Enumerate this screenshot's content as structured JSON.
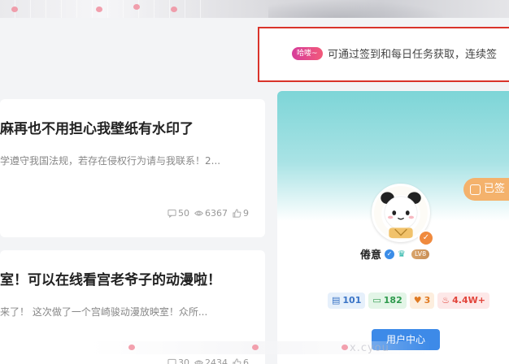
{
  "notice": {
    "tag": "哈喽~",
    "text": "可通过签到和每日任务获取，连续签"
  },
  "posts": [
    {
      "title": "麻再也不用担心我壁纸有水印了",
      "excerpt": "学遵守我国法规，若存在侵权行为请与我联系！2...",
      "comments": "50",
      "views": "6367",
      "likes": "9"
    },
    {
      "title": "室！可以在线看宫老爷子的动漫啦！",
      "excerpt": "来了！ 这次做了一个宫崎骏动漫放映室！众所...",
      "comments": "30",
      "views": "2434",
      "likes": "6"
    }
  ],
  "profile": {
    "signed_label": "已签",
    "username": "倦意",
    "level": "LV8",
    "counters": {
      "posts": "101",
      "comments": "182",
      "likes": "3",
      "popularity": "4.4W+"
    },
    "user_center_label": "用户中心"
  },
  "watermark": "x.cyou",
  "colors": {
    "accent": "#3d8ae8",
    "notice_border": "#d9342b",
    "signed": "#f4b26c"
  }
}
